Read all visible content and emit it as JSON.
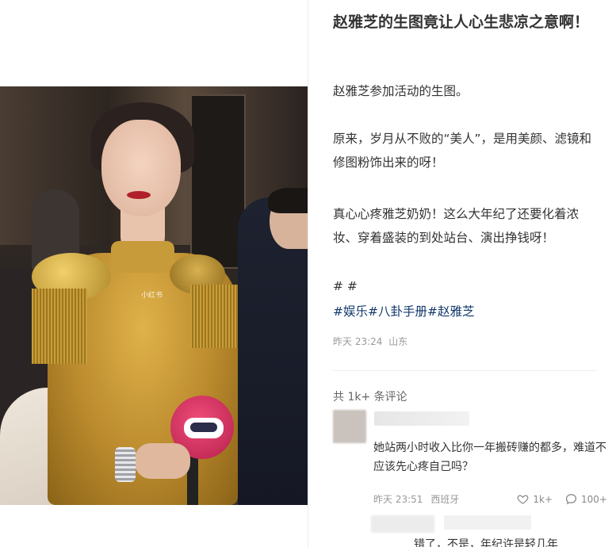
{
  "article": {
    "title": "赵雅芝的生图竟让人心生悲凉之意啊！",
    "paragraph_1": "赵雅芝参加活动的生图。",
    "paragraph_2": "原来，岁月从不败的“美人”，是用美颜、滤镜和修图粉饰出来的呀！",
    "paragraph_3": "真心心疼雅芝奶奶！这么大年纪了还要化着浓妆、穿着盛装的到处站台、演出挣钱呀！",
    "paragraph_4": "# #",
    "tags": [
      "#娱乐",
      "#八卦手册",
      "#赵雅芝"
    ],
    "time": "昨天 23:24",
    "location": "山东"
  },
  "photo": {
    "watermark": "小红书"
  },
  "comments": {
    "count_label": "共 1k+ 条评论",
    "items": [
      {
        "text": "她站两小时收入比你一年搬砖赚的都多，难道不应该先心疼自己吗？",
        "time": "昨天 23:51",
        "location": "西班牙",
        "likes": "1k+",
        "replies": "100+"
      },
      {
        "text": "错了，不是，年纪许是轻几年"
      }
    ]
  },
  "colors": {
    "tag": "#13386c",
    "meta": "#999999",
    "text": "#333333"
  }
}
